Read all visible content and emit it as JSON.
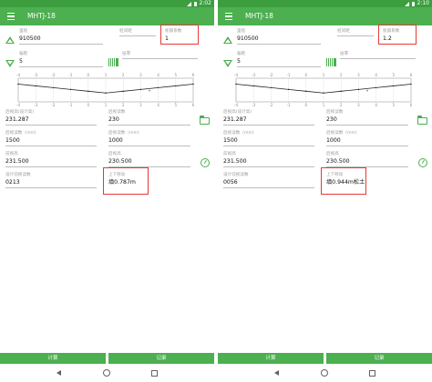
{
  "screens": [
    {
      "status_time": "2:02",
      "app_title": "MHTJ-18",
      "row1": {
        "mileage_label": "里程",
        "mileage_value": "910500",
        "pile_label": "桩间距",
        "pile_value": "",
        "coef_label": "松铺系数",
        "coef_value": "1"
      },
      "row2": {
        "pile_no_label": "偏距",
        "pile_no_value": "5",
        "layer_label": "层厚",
        "layer_value": ""
      },
      "chart_data": {
        "type": "line",
        "x_ticks": [
          "-4",
          "-3",
          "-2",
          "-1",
          "0",
          "1",
          "2",
          "3",
          "4",
          "5",
          "6"
        ],
        "series": [
          {
            "values": [
              0.0,
              -0.3,
              -0.6,
              -0.9,
              -1.2,
              -1.5,
              -1.2,
              -0.9,
              -0.6,
              -0.3,
              0.0
            ]
          }
        ],
        "marker": {
          "x": 3.5,
          "y": -1.1
        },
        "ylim": [
          -3,
          1
        ],
        "grid": true
      },
      "row3": {
        "backsight_label": "后视高(设计高)",
        "backsight_value": "231.287",
        "read_label": "后视读数",
        "read_value": "230"
      },
      "row4": {
        "foresight_label": "后视读数（mm）",
        "foresight_value": "1500",
        "fore_read_label": "后视读数（mm）",
        "fore_read_value": "1000"
      },
      "row5": {
        "elev_label": "前视高",
        "elev_value": "231.500",
        "fore_elev_label": "后视高",
        "fore_elev_value": "230.500"
      },
      "row6": {
        "design_read_label": "设计前视读数",
        "design_read_value": "0213",
        "move_label": "上下移动",
        "move_value": "填0.787m"
      },
      "buttons": {
        "calc": "计算",
        "record": "记录"
      }
    },
    {
      "status_time": "2:10",
      "app_title": "MHTJ-18",
      "row1": {
        "mileage_label": "里程",
        "mileage_value": "910500",
        "pile_label": "桩间距",
        "pile_value": "",
        "coef_label": "松铺系数",
        "coef_value": "1.2"
      },
      "row2": {
        "pile_no_label": "偏距",
        "pile_no_value": "5",
        "layer_label": "层厚",
        "layer_value": ""
      },
      "chart_data": {
        "type": "line",
        "x_ticks": [
          "-4",
          "-3",
          "-2",
          "-1",
          "0",
          "1",
          "2",
          "3",
          "4",
          "5",
          "6"
        ],
        "series": [
          {
            "values": [
              0.0,
              -0.3,
              -0.6,
              -0.9,
              -1.2,
              -1.5,
              -1.2,
              -0.9,
              -0.6,
              -0.3,
              0.0
            ]
          }
        ],
        "marker": {
          "x": 3.5,
          "y": -1.1
        },
        "ylim": [
          -3,
          1
        ],
        "grid": true
      },
      "row3": {
        "backsight_label": "后视高(设计高)",
        "backsight_value": "231.287",
        "read_label": "后视读数",
        "read_value": "230"
      },
      "row4": {
        "foresight_label": "后视读数（mm）",
        "foresight_value": "1500",
        "fore_read_label": "后视读数（mm）",
        "fore_read_value": "1000"
      },
      "row5": {
        "elev_label": "前视高",
        "elev_value": "231.500",
        "fore_elev_label": "后视高",
        "fore_elev_value": "230.500"
      },
      "row6": {
        "design_read_label": "设计前视读数",
        "design_read_value": "0056",
        "move_label": "上下移动",
        "move_value": "填0.944m松土"
      },
      "buttons": {
        "calc": "计算",
        "record": "记录"
      }
    }
  ],
  "colors": {
    "primary": "#4caf50",
    "status": "#3c9e3f",
    "highlight": "#e53935"
  },
  "icons": [
    "menu-icon",
    "triangle-up-icon",
    "triangle-down-icon",
    "barcode-icon",
    "folder-icon",
    "timer-icon",
    "back-icon",
    "home-icon",
    "recent-apps-icon"
  ]
}
